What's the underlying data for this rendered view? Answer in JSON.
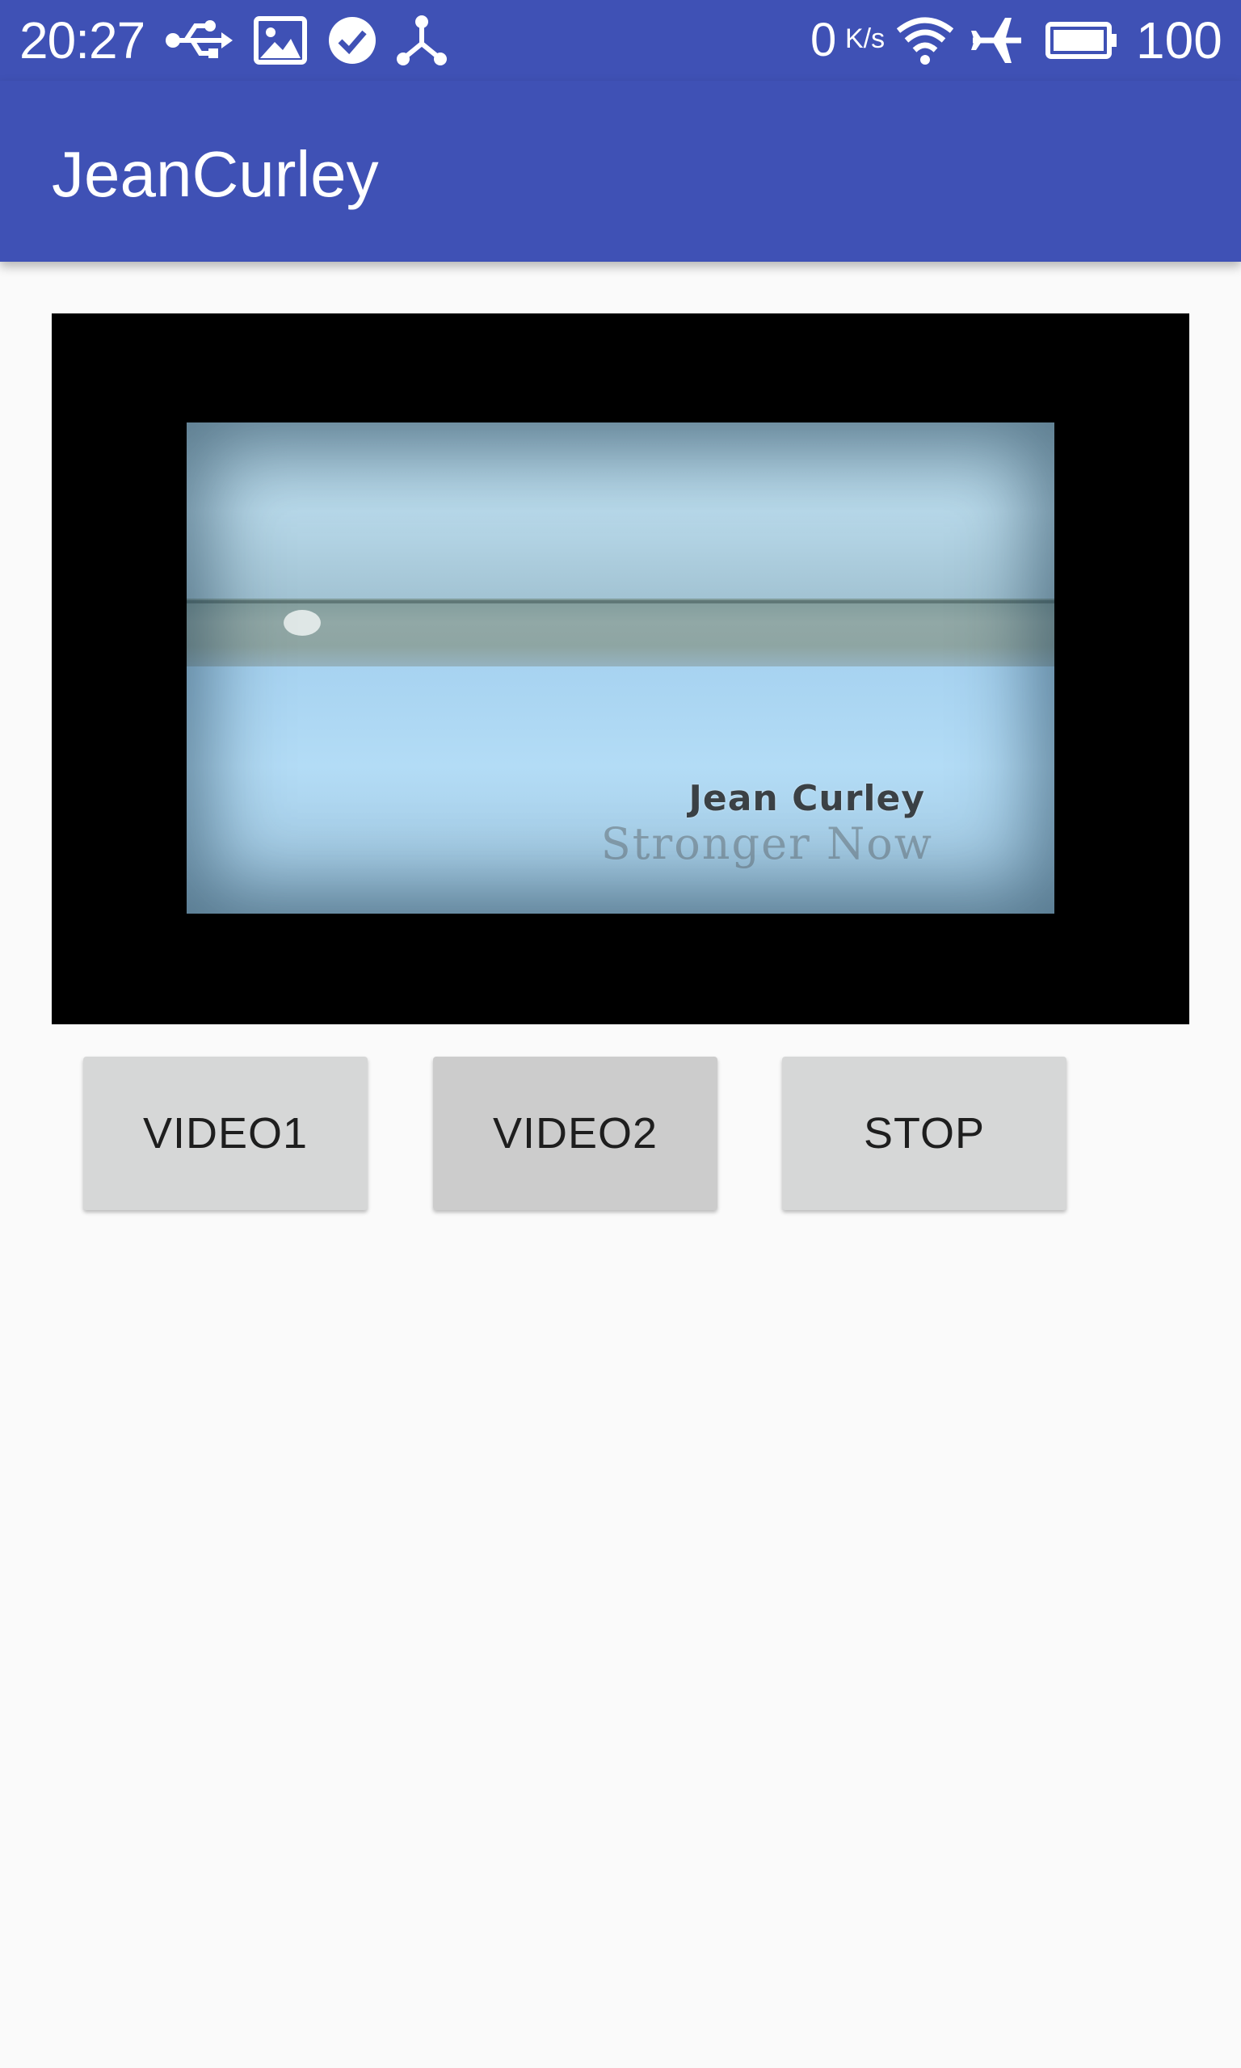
{
  "status_bar": {
    "time": "20:27",
    "left_icons": [
      "usb-icon",
      "image-icon",
      "check-circle-icon",
      "share-icon"
    ],
    "net_speed_value": "0",
    "net_speed_unit": "K/s",
    "right_icons": [
      "wifi-icon",
      "airplane-icon",
      "battery-icon"
    ],
    "battery_percent": "100"
  },
  "app_bar": {
    "title": "JeanCurley"
  },
  "video": {
    "caption_line1": "Jean Curley",
    "caption_line2": "Stronger Now"
  },
  "buttons": {
    "video1": "VIDEO1",
    "video2": "VIDEO2",
    "stop": "STOP"
  },
  "colors": {
    "primary": "#3f51b5",
    "background": "#fafafa",
    "button": "#d6d7d7",
    "video_bg": "#000000"
  }
}
